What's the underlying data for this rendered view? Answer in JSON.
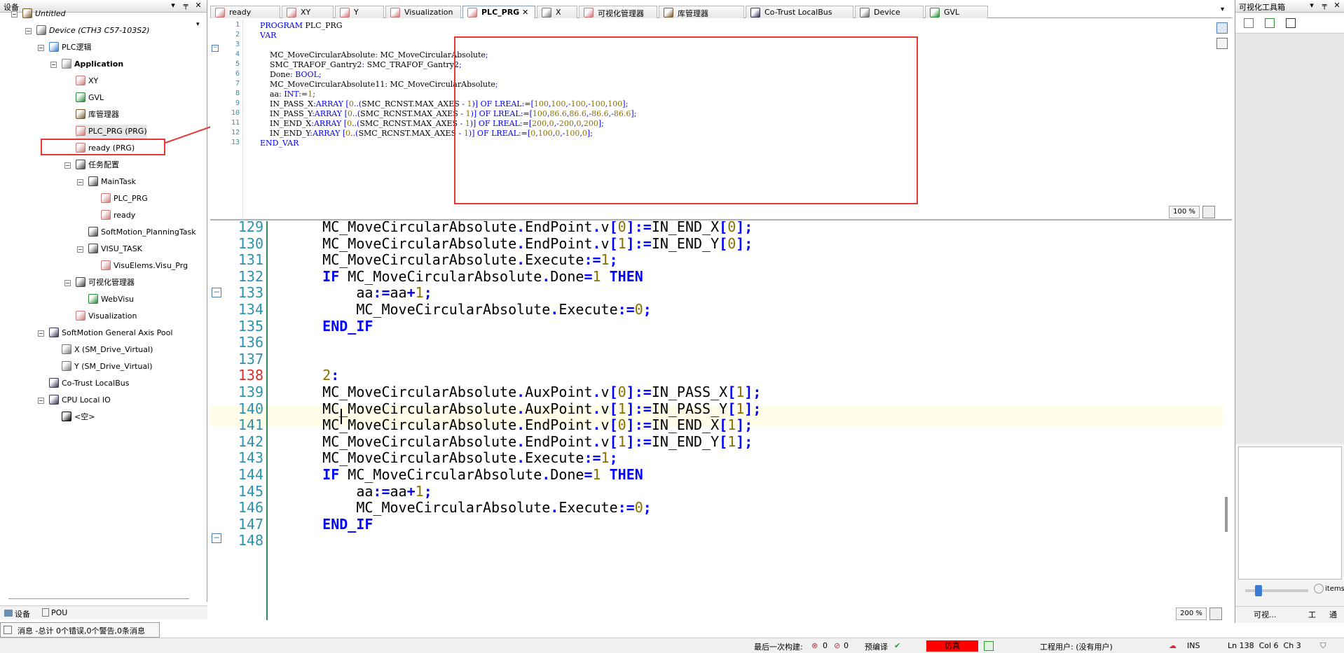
{
  "left_panel": {
    "title": "设备",
    "tree": [
      {
        "label": "Untitled",
        "bold": false,
        "italic": true
      },
      {
        "label": "Device (CTH3 C57-103S2)",
        "bold": false,
        "italic": true
      },
      {
        "label": "PLC逻辑",
        "bold": false,
        "italic": false
      },
      {
        "label": "Application",
        "bold": true,
        "italic": false
      },
      {
        "label": "XY",
        "bold": false,
        "italic": false
      },
      {
        "label": "GVL",
        "bold": false,
        "italic": false
      },
      {
        "label": "库管理器",
        "bold": false,
        "italic": false
      },
      {
        "label": "PLC_PRG (PRG)",
        "bold": false,
        "italic": false
      },
      {
        "label": "ready (PRG)",
        "bold": false,
        "italic": false
      },
      {
        "label": "任务配置",
        "bold": false,
        "italic": false
      },
      {
        "label": "MainTask",
        "bold": false,
        "italic": false
      },
      {
        "label": "PLC_PRG",
        "bold": false,
        "italic": false
      },
      {
        "label": "ready",
        "bold": false,
        "italic": false
      },
      {
        "label": "SoftMotion_PlanningTask",
        "bold": false,
        "italic": false
      },
      {
        "label": "VISU_TASK",
        "bold": false,
        "italic": false
      },
      {
        "label": "VisuElems.Visu_Prg",
        "bold": false,
        "italic": false
      },
      {
        "label": "可视化管理器",
        "bold": false,
        "italic": false
      },
      {
        "label": "WebVisu",
        "bold": false,
        "italic": false
      },
      {
        "label": "Visualization",
        "bold": false,
        "italic": false
      },
      {
        "label": "SoftMotion General Axis Pool",
        "bold": false,
        "italic": false
      },
      {
        "label": "X (SM_Drive_Virtual)",
        "bold": false,
        "italic": false
      },
      {
        "label": "Y (SM_Drive_Virtual)",
        "bold": false,
        "italic": false
      },
      {
        "label": "Co-Trust LocalBus",
        "bold": false,
        "italic": false
      },
      {
        "label": "CPU Local IO",
        "bold": false,
        "italic": false
      },
      {
        "label": "<空>",
        "bold": false,
        "italic": false
      }
    ],
    "bottom_tabs": [
      "设备",
      "POU"
    ]
  },
  "editor_tabs": [
    "ready",
    "XY",
    "Y",
    "Visualization",
    "PLC_PRG",
    "X",
    "可视化管理器",
    "库管理器",
    "Co-Trust LocalBus",
    "Device",
    "GVL"
  ],
  "decl": {
    "zoom": "100 %",
    "lines": [
      {
        "n": "1",
        "t": "PROGRAM PLC_PRG"
      },
      {
        "n": "2",
        "t": "VAR"
      },
      {
        "n": "3",
        "t": ""
      },
      {
        "n": "4",
        "t": "    MC_MoveCircularAbsolute: MC_MoveCircularAbsolute;"
      },
      {
        "n": "5",
        "t": "    SMC_TRAFOF_Gantry2: SMC_TRAFOF_Gantry2;"
      },
      {
        "n": "6",
        "t": "    Done: BOOL;"
      },
      {
        "n": "7",
        "t": "    MC_MoveCircularAbsolute11: MC_MoveCircularAbsolute;"
      },
      {
        "n": "8",
        "t": "    aa: INT:=1;"
      },
      {
        "n": "9",
        "t": "    IN_PASS_X:ARRAY [0..(SMC_RCNST.MAX_AXES - 1)] OF LREAL:=[100,100,-100,-100,100];"
      },
      {
        "n": "10",
        "t": "    IN_PASS_Y:ARRAY [0..(SMC_RCNST.MAX_AXES - 1)] OF LREAL:=[100,86.6,86.6,-86.6,-86.6];"
      },
      {
        "n": "11",
        "t": "    IN_END_X:ARRAY [0..(SMC_RCNST.MAX_AXES - 1)] OF LREAL:=[200,0,-200,0,200];"
      },
      {
        "n": "12",
        "t": "    IN_END_Y:ARRAY [0..(SMC_RCNST.MAX_AXES - 1)] OF LREAL:=[0,100,0,-100,0];"
      },
      {
        "n": "13",
        "t": "END_VAR"
      }
    ]
  },
  "body": {
    "zoom": "200 %",
    "lines": [
      {
        "n": "129",
        "t": "    MC_MoveCircularAbsolute.EndPoint.v[0]:=IN_END_X[0];"
      },
      {
        "n": "130",
        "t": "    MC_MoveCircularAbsolute.EndPoint.v[1]:=IN_END_Y[0];"
      },
      {
        "n": "131",
        "t": "    MC_MoveCircularAbsolute.Execute:=1;"
      },
      {
        "n": "132",
        "t": "    IF MC_MoveCircularAbsolute.Done=1 THEN"
      },
      {
        "n": "133",
        "t": "        aa:=aa+1;"
      },
      {
        "n": "134",
        "t": "        MC_MoveCircularAbsolute.Execute:=0;"
      },
      {
        "n": "135",
        "t": "    END_IF"
      },
      {
        "n": "136",
        "t": ""
      },
      {
        "n": "137",
        "t": ""
      },
      {
        "n": "138",
        "t": "    2:"
      },
      {
        "n": "139",
        "t": "    MC_MoveCircularAbsolute.AuxPoint.v[0]:=IN_PASS_X[1];"
      },
      {
        "n": "140",
        "t": "    MC_MoveCircularAbsolute.AuxPoint.v[1]:=IN_PASS_Y[1];"
      },
      {
        "n": "141",
        "t": "    MC_MoveCircularAbsolute.EndPoint.v[0]:=IN_END_X[1];"
      },
      {
        "n": "142",
        "t": "    MC_MoveCircularAbsolute.EndPoint.v[1]:=IN_END_Y[1];"
      },
      {
        "n": "143",
        "t": "    MC_MoveCircularAbsolute.Execute:=1;"
      },
      {
        "n": "144",
        "t": "    IF MC_MoveCircularAbsolute.Done=1 THEN"
      },
      {
        "n": "145",
        "t": "        aa:=aa+1;"
      },
      {
        "n": "146",
        "t": "        MC_MoveCircularAbsolute.Execute:=0;"
      },
      {
        "n": "147",
        "t": "    END_IF"
      },
      {
        "n": "148",
        "t": ""
      }
    ]
  },
  "right_panel": {
    "title": "可视化工具箱",
    "search_label": "items",
    "bottom_tabs": [
      "可视...",
      "工",
      "通"
    ]
  },
  "message_bar": "消息 -总计 0个错误,0个警告,0条消息",
  "status": {
    "last_build_label": "最后一次构建:",
    "errors": "0",
    "warnings": "0",
    "precompile": "预编译",
    "sim_label": "仿真",
    "project_user": "工程用户: (没有用户)",
    "ins": "INS",
    "position": "Ln 138  Col 6  Ch 3"
  },
  "colors": {
    "highlight_red": "#e53935",
    "keyword": "#0000ff",
    "number": "#8b6f00",
    "linenum": "#2b91af",
    "sim_bg": "#ff0000"
  }
}
